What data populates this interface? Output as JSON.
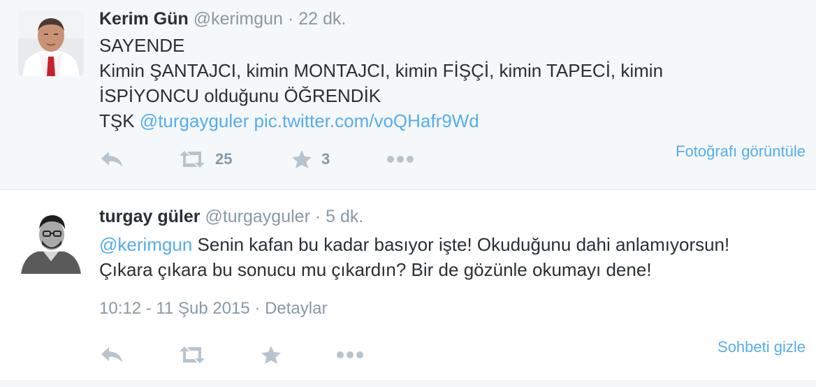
{
  "tweets": [
    {
      "name": "Kerim Gün",
      "handle": "@kerimgun",
      "separator": "·",
      "time": "22 dk.",
      "lines": [
        "SAYENDE",
        "Kimin ŞANTAJCI, kimin MONTAJCI, kimin FİŞÇİ, kimin TAPECİ, kimin",
        "İSPİYONCU olduğunu ÖĞRENDİK"
      ],
      "line4_prefix": "TŞK ",
      "mention": "@turgayguler",
      "space": " ",
      "media_link": "pic.twitter.com/voQHafr9Wd",
      "retweets": "25",
      "favorites": "3",
      "right_link": "Fotoğrafı görüntüle"
    },
    {
      "name": "turgay güler",
      "handle": "@turgayguler",
      "separator": "·",
      "time": "5 dk.",
      "mention": "@kerimgun",
      "line1_rest": " Senin kafan bu kadar basıyor işte! Okuduğunu dahi anlamıyorsun!",
      "line2": "Çıkara çıkara bu sonucu mu çıkardın? Bir de gözünle okumayı dene!",
      "timestamp": "10:12 - 11 Şub 2015",
      "details_separator": " · ",
      "details": "Detaylar",
      "right_link": "Sohbeti gizle"
    }
  ],
  "icons": {
    "reply": "reply-icon",
    "retweet": "retweet-icon",
    "favorite": "star-icon",
    "more": "more-icon"
  },
  "colors": {
    "link": "#55acee",
    "muted": "#8899a6",
    "text": "#292f33",
    "highlight_bg": "#f5f8fa",
    "border": "#e1e8ed"
  }
}
